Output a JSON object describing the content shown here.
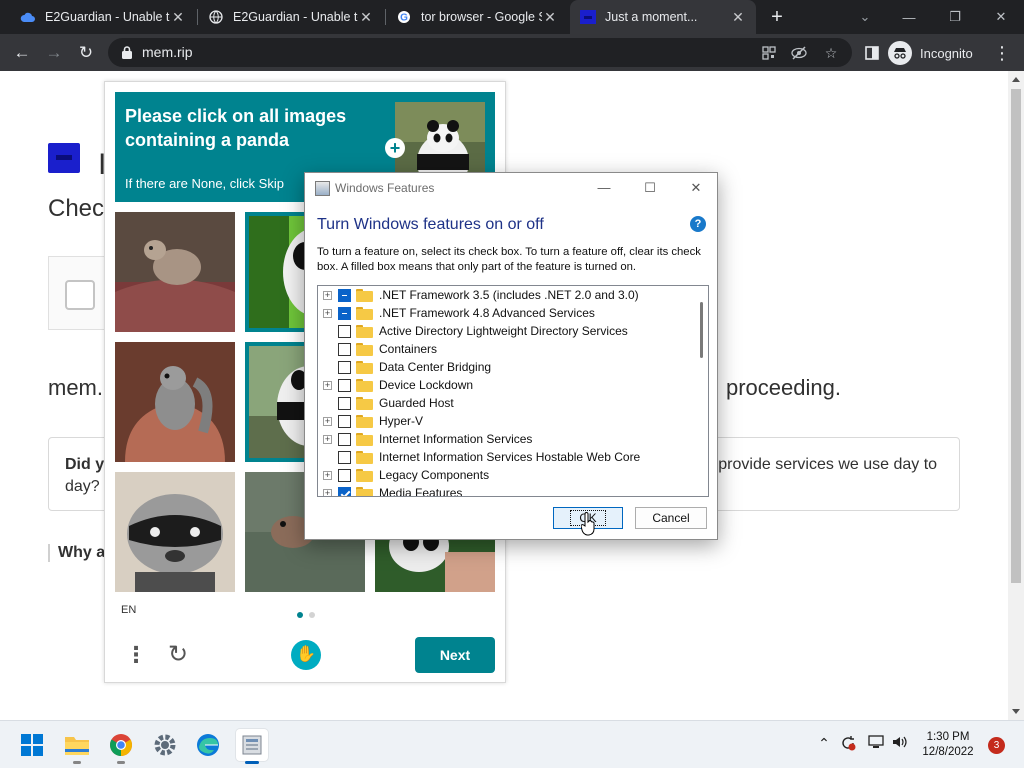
{
  "browser": {
    "tabs": [
      {
        "title": "E2Guardian - Unable to",
        "icon": "cloud-icon"
      },
      {
        "title": "E2Guardian - Unable to",
        "icon": "globe-icon"
      },
      {
        "title": "tor browser - Google S",
        "icon": "google-icon"
      },
      {
        "title": "Just a moment...",
        "icon": "site-icon"
      }
    ],
    "url": "mem.rip",
    "incognito_label": "Incognito"
  },
  "page": {
    "heading_partial": "I",
    "subheading_partial": "Check",
    "body_left": "mem.",
    "body_right": "proceeding.",
    "info_bold": "Did y",
    "info_line2": "day?",
    "info_right": "he Internet because they help provide services we use day to",
    "why_label": "Why a"
  },
  "captcha": {
    "prompt": "Please click on all images containing a panda",
    "skip_hint": "If there are None, click Skip",
    "lang": "EN",
    "next_label": "Next",
    "accent": "#00838f",
    "tiles": [
      {
        "name": "tile-rodent-couch",
        "selected": false
      },
      {
        "name": "tile-panda-1",
        "selected": true
      },
      {
        "name": "tile-squirrel-chair",
        "selected": false
      },
      {
        "name": "tile-panda-2",
        "selected": true
      },
      {
        "name": "tile-raccoon",
        "selected": false
      },
      {
        "name": "tile-otter",
        "selected": false
      },
      {
        "name": "tile-panda-3",
        "selected": false
      }
    ]
  },
  "dialog": {
    "title": "Windows Features",
    "heading": "Turn Windows features on or off",
    "description": "To turn a feature on, select its check box. To turn a feature off, clear its check box. A filled box means that only part of the feature is turned on.",
    "help_label": "?",
    "ok_label": "OK",
    "cancel_label": "Cancel",
    "features": [
      {
        "label": ".NET Framework 3.5 (includes .NET 2.0 and 3.0)",
        "expandable": true,
        "state": "partial"
      },
      {
        "label": ".NET Framework 4.8 Advanced Services",
        "expandable": true,
        "state": "partial"
      },
      {
        "label": "Active Directory Lightweight Directory Services",
        "expandable": false,
        "state": "unchecked"
      },
      {
        "label": "Containers",
        "expandable": false,
        "state": "unchecked"
      },
      {
        "label": "Data Center Bridging",
        "expandable": false,
        "state": "unchecked"
      },
      {
        "label": "Device Lockdown",
        "expandable": true,
        "state": "unchecked"
      },
      {
        "label": "Guarded Host",
        "expandable": false,
        "state": "unchecked"
      },
      {
        "label": "Hyper-V",
        "expandable": true,
        "state": "unchecked"
      },
      {
        "label": "Internet Information Services",
        "expandable": true,
        "state": "unchecked"
      },
      {
        "label": "Internet Information Services Hostable Web Core",
        "expandable": false,
        "state": "unchecked"
      },
      {
        "label": "Legacy Components",
        "expandable": true,
        "state": "unchecked"
      },
      {
        "label": "Media Features",
        "expandable": true,
        "state": "checked"
      }
    ]
  },
  "taskbar": {
    "apps": [
      {
        "name": "start-icon",
        "active": false
      },
      {
        "name": "file-explorer-icon",
        "active": false
      },
      {
        "name": "chrome-icon",
        "active": false
      },
      {
        "name": "settings-icon",
        "active": false
      },
      {
        "name": "edge-icon",
        "active": false
      },
      {
        "name": "windows-features-icon",
        "active": true
      }
    ],
    "time": "1:30 PM",
    "date": "12/8/2022",
    "notification_count": "3"
  }
}
